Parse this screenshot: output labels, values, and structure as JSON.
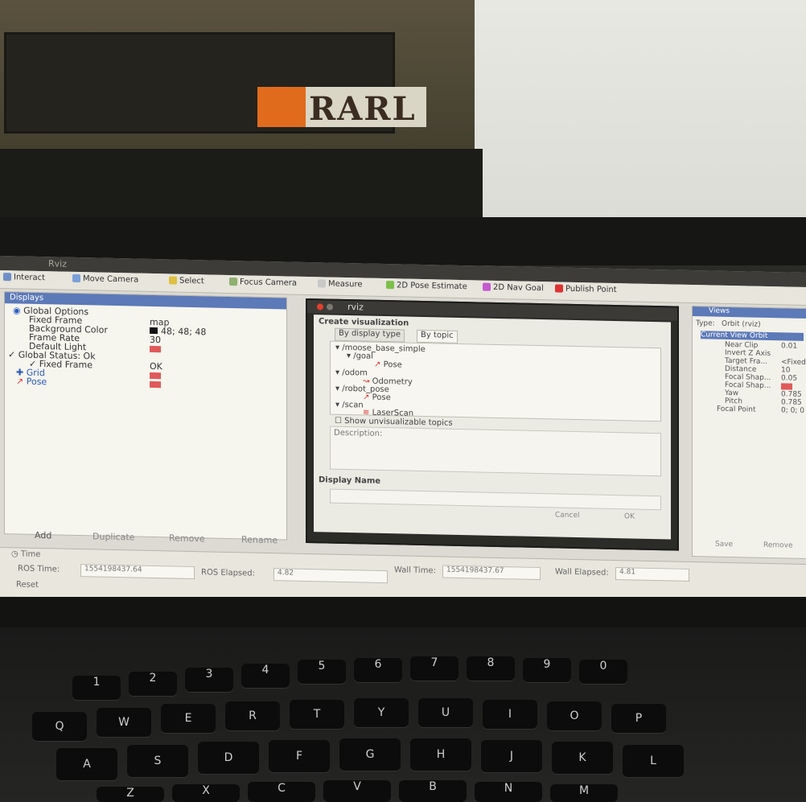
{
  "scene": {
    "sign_text": "RARL"
  },
  "top_menu": {
    "title": "Rviz"
  },
  "toolbar": {
    "items": [
      "Interact",
      "Move Camera",
      "Select",
      "Focus Camera",
      "Measure",
      "2D Pose Estimate",
      "2D Nav Goal",
      "Publish Point"
    ]
  },
  "displays": {
    "header": "Displays",
    "rows": [
      {
        "label": "Global Options",
        "value": ""
      },
      {
        "label": "Fixed Frame",
        "value": "map"
      },
      {
        "label": "Background Color",
        "value": "48; 48; 48"
      },
      {
        "label": "Frame Rate",
        "value": "30"
      },
      {
        "label": "Default Light",
        "value": ""
      },
      {
        "label": "Global Status: Ok",
        "value": ""
      },
      {
        "label": "Fixed Frame",
        "value": "OK"
      },
      {
        "label": "Grid",
        "value": ""
      },
      {
        "label": "Pose",
        "value": ""
      }
    ],
    "buttons": [
      "Add",
      "Duplicate",
      "Remove",
      "Rename"
    ]
  },
  "dialog": {
    "title": "rviz",
    "heading": "Create visualization",
    "tab_display_type": "By display type",
    "tab_topic": "By topic",
    "tree": [
      "/moose_base_simple",
      "/goal",
      "Pose",
      "/odom",
      "Odometry",
      "/robot_pose",
      "Pose",
      "/scan",
      "LaserScan"
    ],
    "show_unvisualizable": "Show unvisualizable topics",
    "description_label": "Description:",
    "display_name_label": "Display Name",
    "cancel": "Cancel",
    "ok": "OK"
  },
  "views": {
    "header": "Views",
    "type_label": "Type:",
    "type_value": "Orbit (rviz)",
    "current_view": "Current View",
    "current_view_value": "Orbit",
    "props": [
      {
        "label": "Near Clip",
        "value": "0.01"
      },
      {
        "label": "Invert Z Axis",
        "value": ""
      },
      {
        "label": "Target Fra...",
        "value": "<Fixed>"
      },
      {
        "label": "Distance",
        "value": "10"
      },
      {
        "label": "Focal Shap...",
        "value": "0.05"
      },
      {
        "label": "Focal Shap...",
        "value": ""
      },
      {
        "label": "Yaw",
        "value": "0.785"
      },
      {
        "label": "Pitch",
        "value": "0.785"
      },
      {
        "label": "Focal Point",
        "value": "0; 0; 0"
      }
    ],
    "save": "Save",
    "remove": "Remove"
  },
  "time": {
    "header": "Time",
    "ros_time_label": "ROS Time:",
    "ros_time_value": "1554198437.64",
    "ros_elapsed_label": "ROS Elapsed:",
    "ros_elapsed_value": "4.82",
    "wall_time_label": "Wall Time:",
    "wall_time_value": "1554198437.67",
    "wall_elapsed_label": "Wall Elapsed:",
    "wall_elapsed_value": "4.81",
    "reset": "Reset"
  },
  "keyboard": {
    "row1": [
      "1",
      "2",
      "3",
      "4",
      "5",
      "6",
      "7",
      "8",
      "9",
      "0"
    ],
    "row2": [
      "Q",
      "W",
      "E",
      "R",
      "T",
      "Y",
      "U",
      "I",
      "O",
      "P"
    ],
    "row3": [
      "A",
      "S",
      "D",
      "F",
      "G",
      "H",
      "J",
      "K",
      "L"
    ],
    "row4": [
      "Z",
      "X",
      "C",
      "V",
      "B",
      "N",
      "M"
    ]
  }
}
